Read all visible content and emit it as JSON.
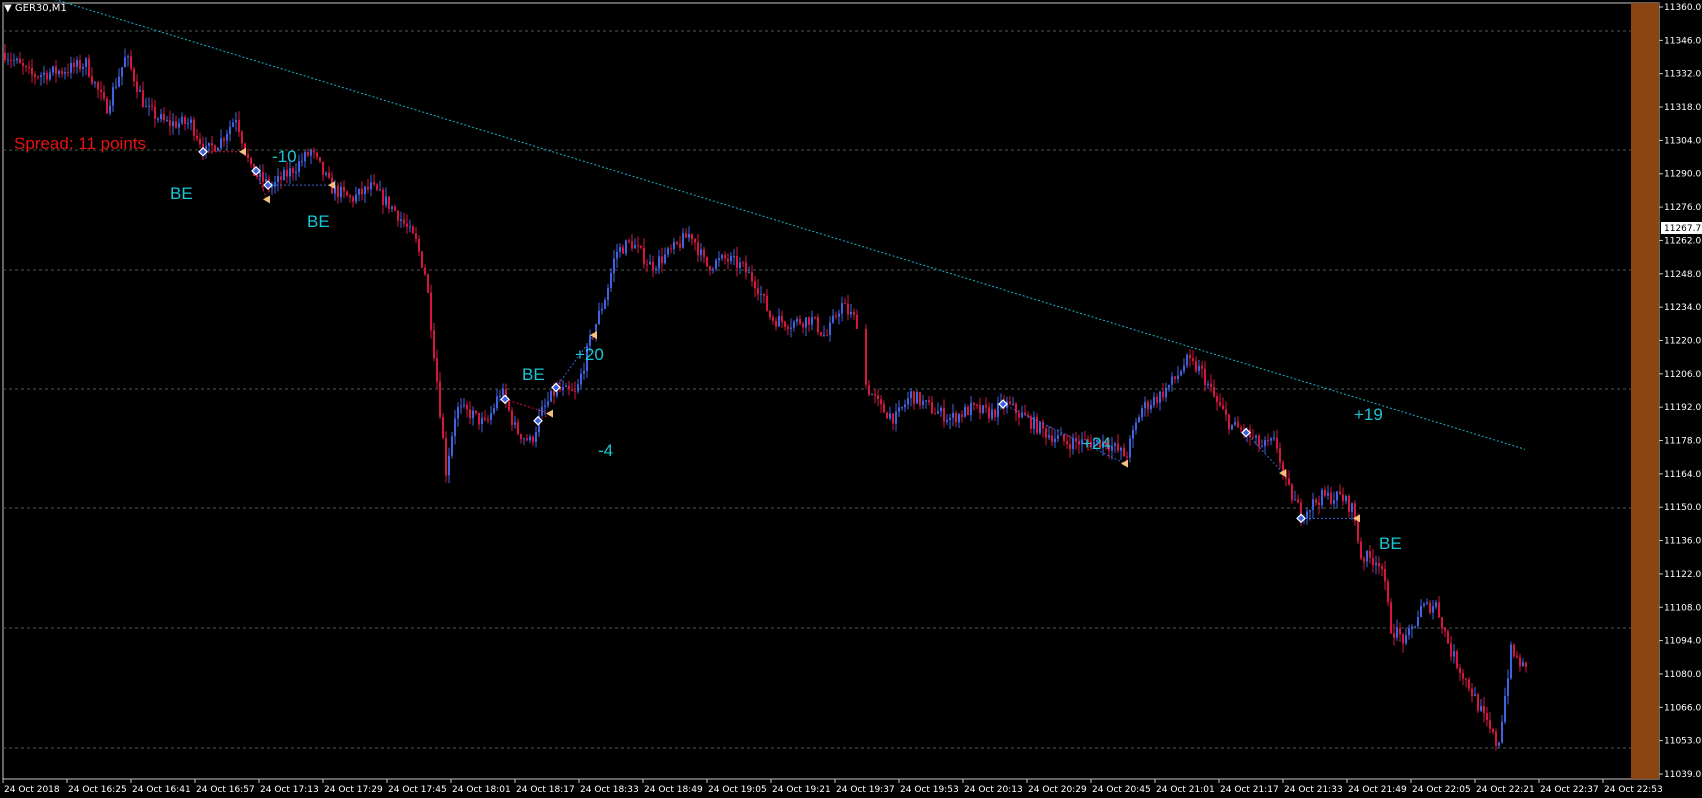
{
  "symbol": "GER30,M1",
  "spread_text": "Spread: 11 points",
  "trade_labels": [
    "-10",
    "BE",
    "BE",
    "BE",
    "+20",
    "-4",
    "+24",
    "+19",
    "BE"
  ],
  "colors": {
    "background": "#000000",
    "bull_candle": "#3f63e0",
    "bear_candle": "#d6163e",
    "grid": "#4a5a4a",
    "trendline": "#19b4c8",
    "trade_label": "#19c8d6",
    "spread_label": "#e8120f",
    "right_band": "#8b4513",
    "axis_text": "#ffffff"
  },
  "chart_data": {
    "type": "candlestick",
    "title": "GER30,M1",
    "ylim": [
      11039.0,
      11360.0
    ],
    "y_ticks": [
      "11360.0",
      "11346.0",
      "11332.0",
      "11318.0",
      "11304.0",
      "11290.0",
      "11276.0",
      "11262.0",
      "11248.0",
      "11234.0",
      "11220.0",
      "11206.0",
      "11192.0",
      "11178.0",
      "11164.0",
      "11150.0",
      "11136.0",
      "11122.0",
      "11108.0",
      "11094.0",
      "11080.0",
      "11066.0",
      "11053.0",
      "11039.0"
    ],
    "current_price": "11267.7",
    "x_ticks": [
      "24 Oct 2018",
      "24 Oct 16:25",
      "24 Oct 16:41",
      "24 Oct 16:57",
      "24 Oct 17:13",
      "24 Oct 17:29",
      "24 Oct 17:45",
      "24 Oct 18:01",
      "24 Oct 18:17",
      "24 Oct 18:33",
      "24 Oct 18:49",
      "24 Oct 19:05",
      "24 Oct 19:21",
      "24 Oct 19:37",
      "24 Oct 19:53",
      "24 Oct 20:13",
      "24 Oct 20:29",
      "24 Oct 20:45",
      "24 Oct 21:01",
      "24 Oct 21:17",
      "24 Oct 21:33",
      "24 Oct 21:49",
      "24 Oct 22:05",
      "24 Oct 22:21",
      "24 Oct 22:37",
      "24 Oct 22:53"
    ],
    "price_path": [
      [
        0,
        11343
      ],
      [
        30,
        11332
      ],
      [
        60,
        11334
      ],
      [
        85,
        11337
      ],
      [
        105,
        11318
      ],
      [
        125,
        11340
      ],
      [
        145,
        11318
      ],
      [
        165,
        11312
      ],
      [
        190,
        11312
      ],
      [
        205,
        11300
      ],
      [
        220,
        11305
      ],
      [
        235,
        11315
      ],
      [
        250,
        11292
      ],
      [
        270,
        11285
      ],
      [
        290,
        11292
      ],
      [
        310,
        11300
      ],
      [
        330,
        11285
      ],
      [
        350,
        11280
      ],
      [
        370,
        11285
      ],
      [
        395,
        11275
      ],
      [
        415,
        11262
      ],
      [
        425,
        11248
      ],
      [
        432,
        11220
      ],
      [
        437,
        11200
      ],
      [
        445,
        11166
      ],
      [
        455,
        11192
      ],
      [
        470,
        11190
      ],
      [
        485,
        11185
      ],
      [
        500,
        11200
      ],
      [
        515,
        11183
      ],
      [
        530,
        11178
      ],
      [
        540,
        11190
      ],
      [
        555,
        11200
      ],
      [
        575,
        11198
      ],
      [
        590,
        11222
      ],
      [
        605,
        11240
      ],
      [
        615,
        11258
      ],
      [
        630,
        11262
      ],
      [
        650,
        11252
      ],
      [
        670,
        11258
      ],
      [
        690,
        11266
      ],
      [
        705,
        11252
      ],
      [
        725,
        11255
      ],
      [
        740,
        11252
      ],
      [
        755,
        11245
      ],
      [
        770,
        11230
      ],
      [
        790,
        11228
      ],
      [
        810,
        11230
      ],
      [
        825,
        11222
      ],
      [
        840,
        11236
      ],
      [
        857,
        11228
      ],
      [
        865,
        11202
      ],
      [
        880,
        11192
      ],
      [
        895,
        11188
      ],
      [
        910,
        11198
      ],
      [
        930,
        11192
      ],
      [
        950,
        11188
      ],
      [
        970,
        11192
      ],
      [
        990,
        11190
      ],
      [
        1005,
        11194
      ],
      [
        1025,
        11188
      ],
      [
        1045,
        11182
      ],
      [
        1065,
        11178
      ],
      [
        1085,
        11178
      ],
      [
        1105,
        11178
      ],
      [
        1125,
        11172
      ],
      [
        1140,
        11192
      ],
      [
        1160,
        11198
      ],
      [
        1175,
        11205
      ],
      [
        1185,
        11212
      ],
      [
        1200,
        11208
      ],
      [
        1215,
        11195
      ],
      [
        1230,
        11185
      ],
      [
        1245,
        11182
      ],
      [
        1260,
        11176
      ],
      [
        1275,
        11178
      ],
      [
        1285,
        11160
      ],
      [
        1300,
        11148
      ],
      [
        1320,
        11155
      ],
      [
        1340,
        11155
      ],
      [
        1352,
        11150
      ],
      [
        1360,
        11130
      ],
      [
        1380,
        11128
      ],
      [
        1390,
        11100
      ],
      [
        1405,
        11094
      ],
      [
        1420,
        11108
      ],
      [
        1435,
        11110
      ],
      [
        1450,
        11090
      ],
      [
        1470,
        11074
      ],
      [
        1485,
        11060
      ],
      [
        1497,
        11050
      ],
      [
        1510,
        11090
      ],
      [
        1525,
        11082
      ]
    ],
    "trendline": [
      [
        55,
        11364
      ],
      [
        1525,
        11175
      ]
    ],
    "trade_points": [
      {
        "x": 203,
        "price": 11300,
        "kind": "entry"
      },
      {
        "x": 243,
        "price": 11300,
        "kind": "exit"
      },
      {
        "x": 256,
        "price": 11292,
        "kind": "entry"
      },
      {
        "x": 268,
        "price": 11286,
        "kind": "entry"
      },
      {
        "x": 267,
        "price": 11280,
        "kind": "exit"
      },
      {
        "x": 332,
        "price": 11286,
        "kind": "exit"
      },
      {
        "x": 505,
        "price": 11196,
        "kind": "entry"
      },
      {
        "x": 550,
        "price": 11190,
        "kind": "exit"
      },
      {
        "x": 538,
        "price": 11187,
        "kind": "entry"
      },
      {
        "x": 556,
        "price": 11201,
        "kind": "entry"
      },
      {
        "x": 594,
        "price": 11223,
        "kind": "exit"
      },
      {
        "x": 1003,
        "price": 11194,
        "kind": "entry"
      },
      {
        "x": 1125,
        "price": 11169,
        "kind": "exit"
      },
      {
        "x": 1246,
        "price": 11182,
        "kind": "entry"
      },
      {
        "x": 1283,
        "price": 11165,
        "kind": "exit"
      },
      {
        "x": 1301,
        "price": 11146,
        "kind": "entry"
      },
      {
        "x": 1357,
        "price": 11146,
        "kind": "exit"
      }
    ],
    "grid": true
  }
}
